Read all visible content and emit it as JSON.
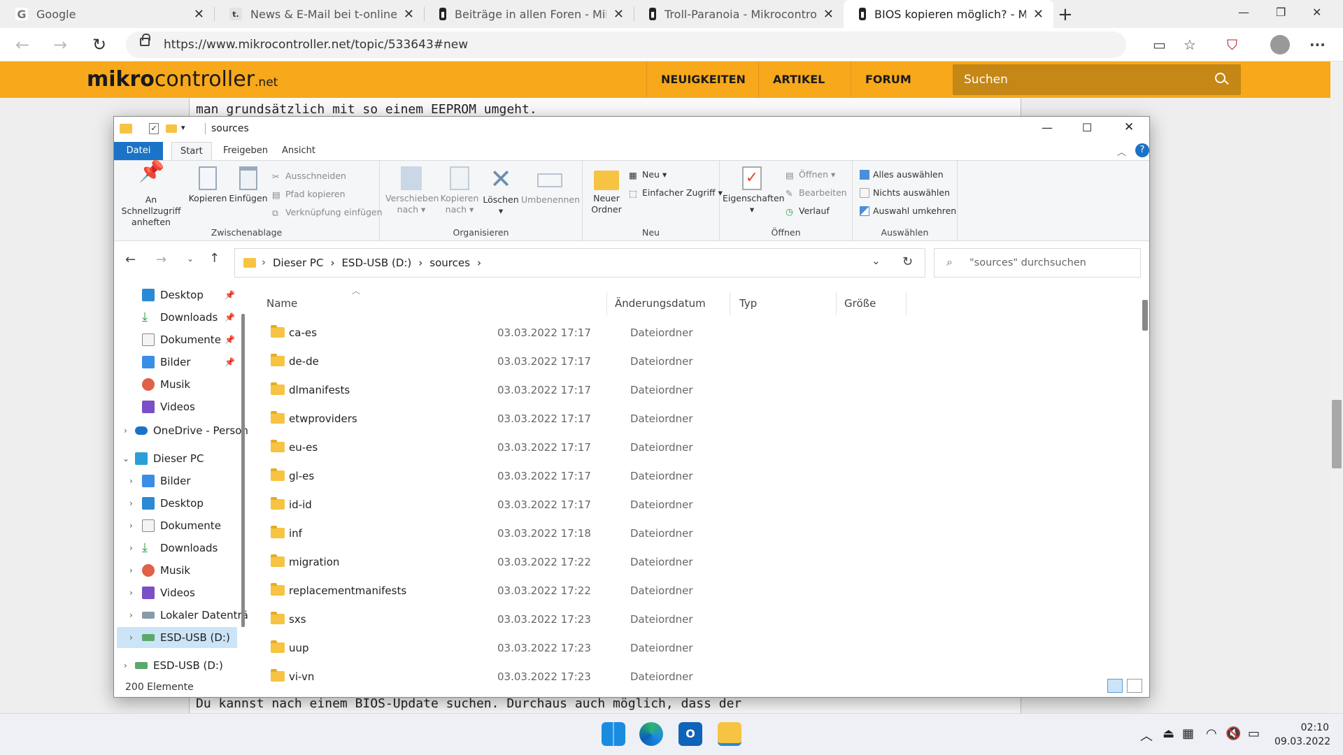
{
  "browser": {
    "tabs": [
      {
        "title": "Google",
        "active": false
      },
      {
        "title": "News & E-Mail bei t-online.de | N",
        "active": false
      },
      {
        "title": "Beiträge in allen Foren - Mikroco",
        "active": false
      },
      {
        "title": "Troll-Paranoia - Mikrocontroller.n",
        "active": false
      },
      {
        "title": "BIOS kopieren möglich? - Mikroc",
        "active": true
      }
    ],
    "url": "https://www.mikrocontroller.net/topic/533643#new"
  },
  "site": {
    "logo_bold": "mikro",
    "logo_rest": "controller",
    "logo_net": ".net",
    "nav": [
      "NEUIGKEITEN",
      "ARTIKEL",
      "FORUM"
    ],
    "search_placeholder": "Suchen",
    "post_line_top": "man grundsätzlich mit so einem EEPROM umgeht.",
    "post_line_bottom": "Du kannst nach einem BIOS-Update suchen. Durchaus auch möglich, dass der"
  },
  "explorer": {
    "title": "sources",
    "ribbon_tabs": [
      "Datei",
      "Start",
      "Freigeben",
      "Ansicht"
    ],
    "ribbon": {
      "zwischenablage": {
        "label": "Zwischenablage",
        "pin_l1": "An Schnellzugriff",
        "pin_l2": "anheften",
        "copy": "Kopieren",
        "paste": "Einfügen",
        "cut": "Ausschneiden",
        "copy_path": "Pfad kopieren",
        "paste_link": "Verknüpfung einfügen"
      },
      "organisieren": {
        "label": "Organisieren",
        "move_l1": "Verschieben",
        "move_l2": "nach",
        "copyto_l1": "Kopieren",
        "copyto_l2": "nach",
        "delete": "Löschen",
        "rename": "Umbenennen"
      },
      "neu": {
        "label": "Neu",
        "new_folder_l1": "Neuer",
        "new_folder_l2": "Ordner",
        "new": "Neu",
        "easy_access": "Einfacher Zugriff"
      },
      "oeffnen": {
        "label": "Öffnen",
        "properties": "Eigenschaften",
        "open": "Öffnen",
        "edit": "Bearbeiten",
        "history": "Verlauf"
      },
      "auswaehlen": {
        "label": "Auswählen",
        "select_all": "Alles auswählen",
        "select_none": "Nichts auswählen",
        "invert": "Auswahl umkehren"
      }
    },
    "breadcrumb": [
      "Dieser PC",
      "ESD-USB (D:)",
      "sources"
    ],
    "search_placeholder": "\"sources\" durchsuchen",
    "sidebar": {
      "quick": [
        {
          "label": "Desktop",
          "icon": "desktop-icon"
        },
        {
          "label": "Downloads",
          "icon": "download-icon"
        },
        {
          "label": "Dokumente",
          "icon": "documents-icon"
        },
        {
          "label": "Bilder",
          "icon": "pictures-icon"
        },
        {
          "label": "Musik",
          "icon": "music-icon"
        },
        {
          "label": "Videos",
          "icon": "videos-icon"
        }
      ],
      "onedrive": "OneDrive - Person",
      "pc": "Dieser PC",
      "pc_items": [
        {
          "label": "Bilder",
          "icon": "pictures-icon"
        },
        {
          "label": "Desktop",
          "icon": "desktop-icon"
        },
        {
          "label": "Dokumente",
          "icon": "documents-icon"
        },
        {
          "label": "Downloads",
          "icon": "download-icon"
        },
        {
          "label": "Musik",
          "icon": "music-icon"
        },
        {
          "label": "Videos",
          "icon": "videos-icon"
        },
        {
          "label": "Lokaler Datenträ",
          "icon": "drive-icon"
        },
        {
          "label": "ESD-USB (D:)",
          "icon": "usb-drive-icon"
        }
      ],
      "usb_root": "ESD-USB (D:)"
    },
    "columns": [
      "Name",
      "Änderungsdatum",
      "Typ",
      "Größe"
    ],
    "files": [
      {
        "name": "ca-es",
        "date": "03.03.2022 17:17",
        "type": "Dateiordner"
      },
      {
        "name": "de-de",
        "date": "03.03.2022 17:17",
        "type": "Dateiordner"
      },
      {
        "name": "dlmanifests",
        "date": "03.03.2022 17:17",
        "type": "Dateiordner"
      },
      {
        "name": "etwproviders",
        "date": "03.03.2022 17:17",
        "type": "Dateiordner"
      },
      {
        "name": "eu-es",
        "date": "03.03.2022 17:17",
        "type": "Dateiordner"
      },
      {
        "name": "gl-es",
        "date": "03.03.2022 17:17",
        "type": "Dateiordner"
      },
      {
        "name": "id-id",
        "date": "03.03.2022 17:17",
        "type": "Dateiordner"
      },
      {
        "name": "inf",
        "date": "03.03.2022 17:18",
        "type": "Dateiordner"
      },
      {
        "name": "migration",
        "date": "03.03.2022 17:22",
        "type": "Dateiordner"
      },
      {
        "name": "replacementmanifests",
        "date": "03.03.2022 17:22",
        "type": "Dateiordner"
      },
      {
        "name": "sxs",
        "date": "03.03.2022 17:23",
        "type": "Dateiordner"
      },
      {
        "name": "uup",
        "date": "03.03.2022 17:23",
        "type": "Dateiordner"
      },
      {
        "name": "vi-vn",
        "date": "03.03.2022 17:23",
        "type": "Dateiordner"
      }
    ],
    "status": "200 Elemente"
  },
  "taskbar": {
    "apps": [
      "windows-start-icon",
      "edge-icon",
      "outlook-icon",
      "file-explorer-icon"
    ],
    "time": "02:10",
    "date": "09.03.2022"
  },
  "colors": {
    "site_orange": "#f7a81b",
    "ribbon_file_blue": "#1a73c7",
    "folder_yellow": "#f6c343"
  }
}
